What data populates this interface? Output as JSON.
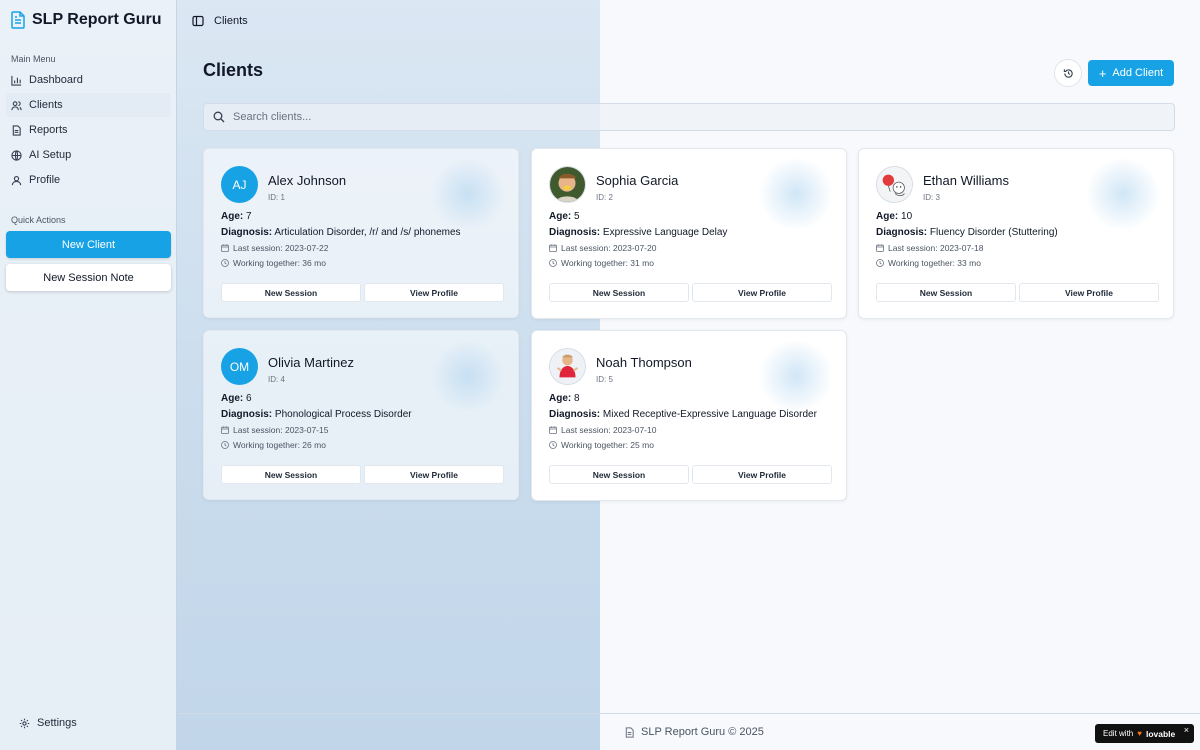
{
  "app": {
    "title": "SLP Report Guru"
  },
  "sidebar": {
    "main_menu_label": "Main Menu",
    "items": [
      {
        "label": "Dashboard",
        "icon": "bar-chart-icon",
        "active": false
      },
      {
        "label": "Clients",
        "icon": "users-icon",
        "active": true
      },
      {
        "label": "Reports",
        "icon": "file-text-icon",
        "active": false
      },
      {
        "label": "AI Setup",
        "icon": "globe-icon",
        "active": false
      },
      {
        "label": "Profile",
        "icon": "user-icon",
        "active": false
      }
    ],
    "quick_actions_label": "Quick Actions",
    "new_client_label": "New Client",
    "new_session_note_label": "New Session Note",
    "settings_label": "Settings"
  },
  "header": {
    "breadcrumb": "Clients"
  },
  "main": {
    "title": "Clients",
    "add_client_label": "Add Client",
    "search_placeholder": "Search clients...",
    "accent_color": "#17a2e6"
  },
  "clients": [
    {
      "name": "Alex Johnson",
      "id": "ID: 1",
      "initials": "AJ",
      "avatar_type": "initials",
      "age_label": "Age:",
      "age": "7",
      "diagnosis_label": "Diagnosis:",
      "diagnosis": "Articulation Disorder, /r/ and /s/ phonemes",
      "last_session": "Last session: 2023-07-22",
      "working_together": "Working together: 36 mo",
      "new_session_label": "New Session",
      "view_profile_label": "View Profile"
    },
    {
      "name": "Sophia Garcia",
      "id": "ID: 2",
      "initials": "",
      "avatar_type": "photo-child-icon",
      "age_label": "Age:",
      "age": "5",
      "diagnosis_label": "Diagnosis:",
      "diagnosis": "Expressive Language Delay",
      "last_session": "Last session: 2023-07-20",
      "working_together": "Working together: 31 mo",
      "new_session_label": "New Session",
      "view_profile_label": "View Profile"
    },
    {
      "name": "Ethan Williams",
      "id": "ID: 3",
      "initials": "",
      "avatar_type": "cartoon-balloon-icon",
      "age_label": "Age:",
      "age": "10",
      "diagnosis_label": "Diagnosis:",
      "diagnosis": "Fluency Disorder (Stuttering)",
      "last_session": "Last session: 2023-07-18",
      "working_together": "Working together: 33 mo",
      "new_session_label": "New Session",
      "view_profile_label": "View Profile"
    },
    {
      "name": "Olivia Martinez",
      "id": "ID: 4",
      "initials": "OM",
      "avatar_type": "initials",
      "age_label": "Age:",
      "age": "6",
      "diagnosis_label": "Diagnosis:",
      "diagnosis": "Phonological Process Disorder",
      "last_session": "Last session: 2023-07-15",
      "working_together": "Working together: 26 mo",
      "new_session_label": "New Session",
      "view_profile_label": "View Profile"
    },
    {
      "name": "Noah Thompson",
      "id": "ID: 5",
      "initials": "",
      "avatar_type": "photo-child-red-icon",
      "age_label": "Age:",
      "age": "8",
      "diagnosis_label": "Diagnosis:",
      "diagnosis": "Mixed Receptive-Expressive Language Disorder",
      "last_session": "Last session: 2023-07-10",
      "working_together": "Working together: 25 mo",
      "new_session_label": "New Session",
      "view_profile_label": "View Profile"
    }
  ],
  "footer": {
    "text": "SLP Report Guru © 2025"
  },
  "badge": {
    "prefix": "Edit with",
    "brand": "lovable",
    "close": "×"
  }
}
